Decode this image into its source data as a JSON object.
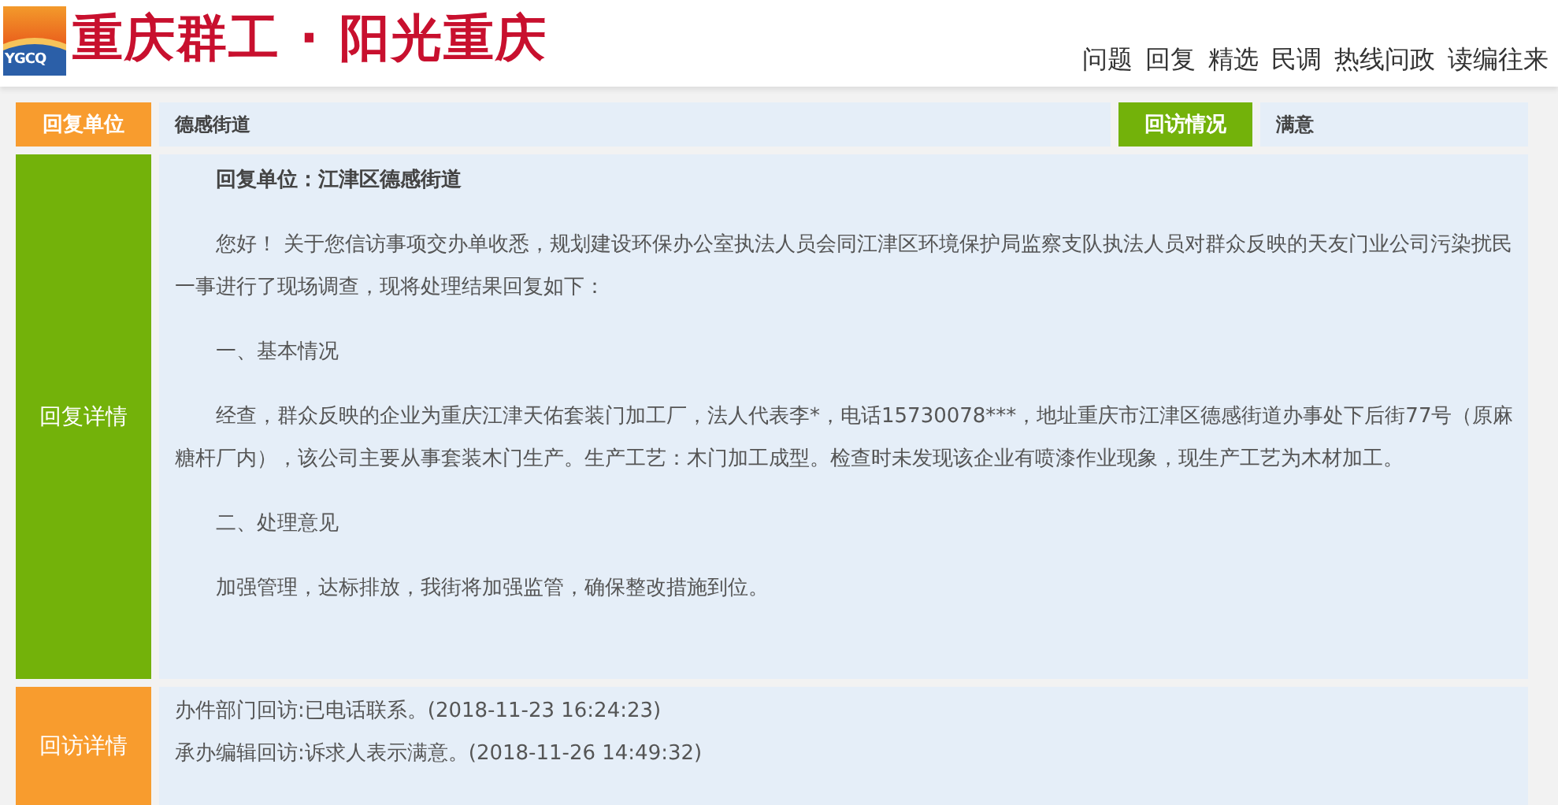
{
  "header": {
    "logo_text": "YGCQ",
    "title": "重庆群工 · 阳光重庆",
    "nav": [
      {
        "label": "问题"
      },
      {
        "label": "回复"
      },
      {
        "label": "精选"
      },
      {
        "label": "民调"
      },
      {
        "label": "热线问政"
      },
      {
        "label": "读编往来"
      }
    ]
  },
  "reply_unit": {
    "label": "回复单位",
    "value": "德感街道",
    "followup_label": "回访情况",
    "followup_value": "满意"
  },
  "reply_detail": {
    "label": "回复详情",
    "paragraphs": [
      {
        "kind": "heading",
        "text": "回复单位：江津区德感街道"
      },
      {
        "kind": "body",
        "text": "您好！ 关于您信访事项交办单收悉，规划建设环保办公室执法人员会同江津区环境保护局监察支队执法人员对群众反映的天友门业公司污染扰民一事进行了现场调查，现将处理结果回复如下："
      },
      {
        "kind": "body",
        "text": "一、基本情况"
      },
      {
        "kind": "body",
        "text": "经查，群众反映的企业为重庆江津天佑套装门加工厂，法人代表李*，电话15730078***，地址重庆市江津区德感街道办事处下后街77号（原麻糖杆厂内），该公司主要从事套装木门生产。生产工艺：木门加工成型。检查时未发现该企业有喷漆作业现象，现生产工艺为木材加工。"
      },
      {
        "kind": "body",
        "text": "二、处理意见"
      },
      {
        "kind": "body",
        "text": "加强管理，达标排放，我街将加强监管，确保整改措施到位。"
      }
    ]
  },
  "followup_detail": {
    "label": "回访详情",
    "entries": [
      "办件部门回访:已电话联系。(2018-11-23 16:24:23)",
      "承办编辑回访:诉求人表示满意。(2018-11-26 14:49:32)"
    ]
  }
}
